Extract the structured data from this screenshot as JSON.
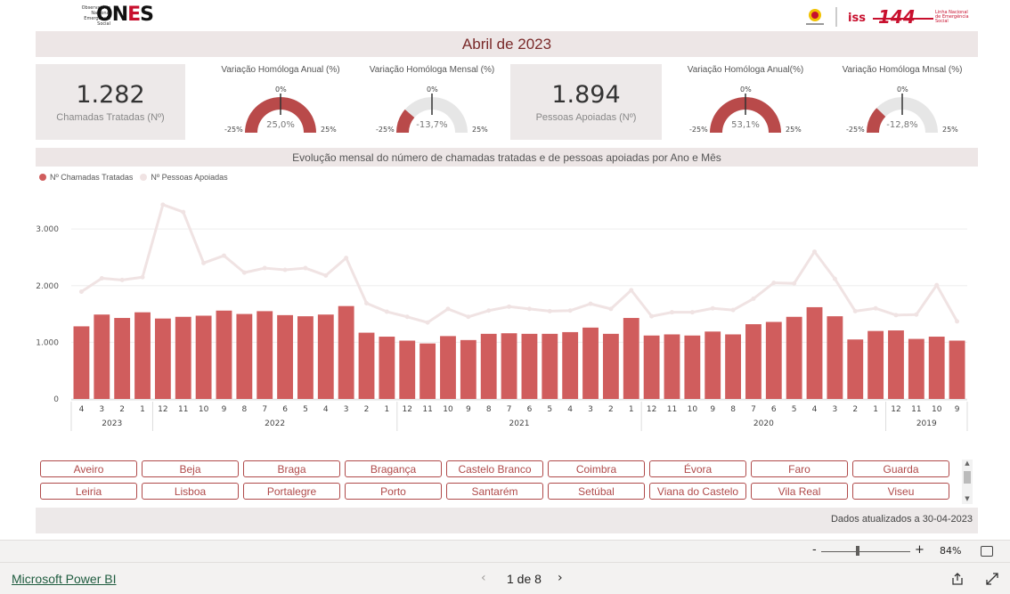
{
  "header": {
    "org_small": [
      "Observatório",
      "Nacional Emergência",
      "Social"
    ],
    "org_big": "ONES",
    "partner_logo_text": "144",
    "partner_small": [
      "Linha Nacional",
      "de Emergência",
      "Social"
    ]
  },
  "report_title": "Abril de 2023",
  "kpis": [
    {
      "value": "1.282",
      "label": "Chamadas Tratadas (Nº)"
    },
    {
      "value": "1.894",
      "label": "Pessoas Apoiadas (Nº)"
    }
  ],
  "gauges": [
    {
      "title": "Variação Homóloga Anual (%)",
      "min": "-25%",
      "max": "25%",
      "mid": "0%",
      "value_label": "25,0%",
      "value": 25.0
    },
    {
      "title": "Variação Homóloga Mensal (%)",
      "min": "-25%",
      "max": "25%",
      "mid": "0%",
      "value_label": "-13,7%",
      "value": -13.7
    },
    {
      "title": "Variação Homóloga Anual(%)",
      "min": "-25%",
      "max": "25%",
      "mid": "0%",
      "value_label": "53,1%",
      "value": 53.1
    },
    {
      "title": "Variação Homóloga Mnsal (%)",
      "min": "-25%",
      "max": "25%",
      "mid": "0%",
      "value_label": "-12,8%",
      "value": -12.8
    }
  ],
  "chart_title": "Evolução mensal do número de chamadas tratadas e de pessoas apoiadas por Ano e Mês",
  "chart_data": {
    "type": "bar",
    "series": [
      {
        "name": "Nº Chamadas Tratadas",
        "type": "bar",
        "color": "#d05d5d",
        "values": [
          1282,
          1490,
          1430,
          1530,
          1420,
          1450,
          1470,
          1560,
          1500,
          1550,
          1480,
          1460,
          1490,
          1640,
          1170,
          1100,
          1030,
          980,
          1110,
          1040,
          1150,
          1160,
          1150,
          1150,
          1180,
          1260,
          1150,
          1430,
          1120,
          1140,
          1120,
          1190,
          1140,
          1320,
          1360,
          1450,
          1620,
          1460,
          1050,
          1200,
          1210,
          1060,
          1100,
          1030
        ]
      },
      {
        "name": "Nº Pessoas Apoiadas",
        "type": "line",
        "color": "#f0e3e3",
        "values": [
          1894,
          2130,
          2100,
          2150,
          3430,
          3300,
          2400,
          2530,
          2230,
          2310,
          2280,
          2310,
          2180,
          2490,
          1690,
          1540,
          1450,
          1350,
          1590,
          1450,
          1560,
          1630,
          1590,
          1550,
          1560,
          1680,
          1590,
          1920,
          1460,
          1530,
          1530,
          1600,
          1570,
          1770,
          2050,
          2040,
          2600,
          2120,
          1550,
          1600,
          1480,
          1490,
          2010,
          1370
        ]
      }
    ],
    "x_months": [
      "4",
      "3",
      "2",
      "1",
      "12",
      "11",
      "10",
      "9",
      "8",
      "7",
      "6",
      "5",
      "4",
      "3",
      "2",
      "1",
      "12",
      "11",
      "10",
      "9",
      "8",
      "7",
      "6",
      "5",
      "4",
      "3",
      "2",
      "1",
      "12",
      "11",
      "10",
      "9",
      "8",
      "7",
      "6",
      "5",
      "4",
      "3",
      "2",
      "1",
      "12",
      "11",
      "10",
      "9"
    ],
    "x_years": [
      {
        "label": "2023",
        "count": 4
      },
      {
        "label": "2022",
        "count": 12
      },
      {
        "label": "2021",
        "count": 12
      },
      {
        "label": "2020",
        "count": 12
      },
      {
        "label": "2019",
        "count": 4
      }
    ],
    "y_ticks": [
      "0",
      "1.000",
      "2.000",
      "3.000"
    ],
    "ylim": [
      0,
      3600
    ],
    "legend_position": "top-left"
  },
  "cities": [
    "Aveiro",
    "Beja",
    "Braga",
    "Bragança",
    "Castelo Branco",
    "Coimbra",
    "Évora",
    "Faro",
    "Guarda",
    "Leiria",
    "Lisboa",
    "Portalegre",
    "Porto",
    "Santarém",
    "Setúbal",
    "Viana do Castelo",
    "Vila Real",
    "Viseu"
  ],
  "footer_text": "Dados atualizados a 30-04-2023",
  "zoom": {
    "minus": "-",
    "plus": "+",
    "level": "84%"
  },
  "bottom": {
    "brand": "Microsoft Power BI",
    "page": "1 de 8"
  }
}
